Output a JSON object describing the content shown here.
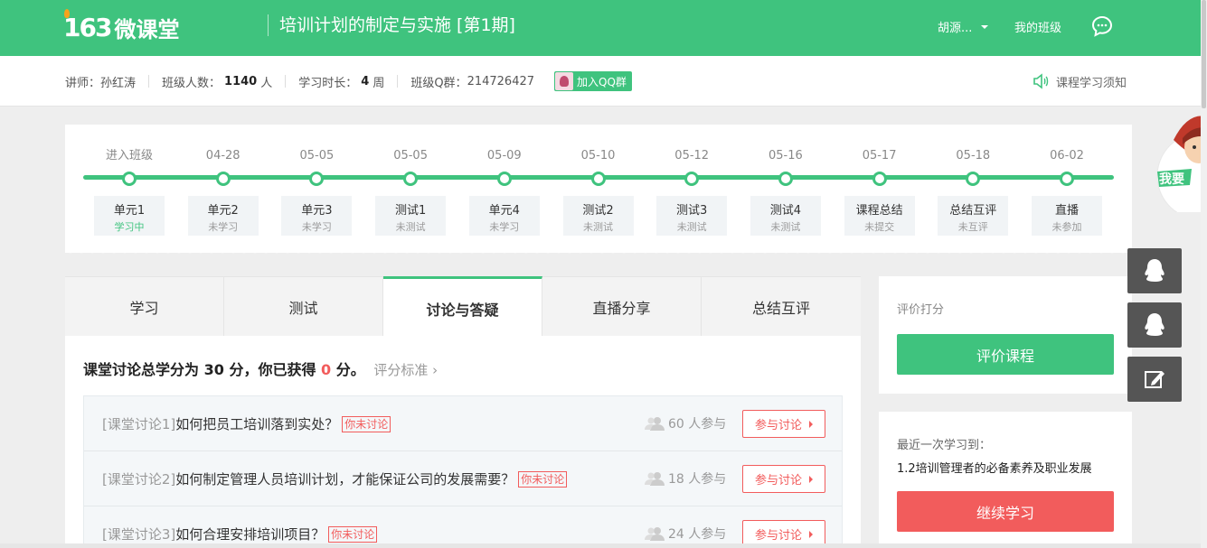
{
  "header": {
    "logo_num": "163",
    "logo_text": "微课堂",
    "course_title": "培训计划的制定与实施 [第1期]",
    "user_name": "胡源...",
    "my_class": "我的班级"
  },
  "info": {
    "teacher_label": "讲师：",
    "teacher_name": "孙红涛",
    "count_label": "班级人数：",
    "count_value": "1140",
    "count_unit": "人",
    "duration_label": "学习时长：",
    "duration_value": "4",
    "duration_unit": "周",
    "qq_group_label": "班级Q群：",
    "qq_group_number": "214726427",
    "join_qq": "加入QQ群",
    "notice": "课程学习须知"
  },
  "timeline": [
    {
      "date": "进入班级",
      "title": "单元1",
      "status": "学习中",
      "active": true
    },
    {
      "date": "04-28",
      "title": "单元2",
      "status": "未学习"
    },
    {
      "date": "05-05",
      "title": "单元3",
      "status": "未学习"
    },
    {
      "date": "05-05",
      "title": "测试1",
      "status": "未测试"
    },
    {
      "date": "05-09",
      "title": "单元4",
      "status": "未学习"
    },
    {
      "date": "05-10",
      "title": "测试2",
      "status": "未测试"
    },
    {
      "date": "05-12",
      "title": "测试3",
      "status": "未测试"
    },
    {
      "date": "05-16",
      "title": "测试4",
      "status": "未测试"
    },
    {
      "date": "05-17",
      "title": "课程总结",
      "status": "未提交"
    },
    {
      "date": "05-18",
      "title": "总结互评",
      "status": "未互评"
    },
    {
      "date": "06-02",
      "title": "直播",
      "status": "未参加"
    }
  ],
  "tabs": [
    {
      "label": "学习"
    },
    {
      "label": "测试"
    },
    {
      "label": "讨论与答疑",
      "active": true
    },
    {
      "label": "直播分享"
    },
    {
      "label": "总结互评"
    }
  ],
  "discussion": {
    "summary_prefix": "课堂讨论总学分为",
    "total_score": "30",
    "summary_mid": "分，你已获得",
    "earned_score": "0",
    "summary_suffix": "分。",
    "criteria_link": "评分标准",
    "items": [
      {
        "tag": "[课堂讨论1]",
        "question": "如何把员工培训落到实处？",
        "badge": "你未讨论",
        "participants": "60 人参与",
        "button": "参与讨论"
      },
      {
        "tag": "[课堂讨论2]",
        "question": "如何制定管理人员培训计划，才能保证公司的发展需要？",
        "badge": "你未讨论",
        "participants": "18 人参与",
        "button": "参与讨论"
      },
      {
        "tag": "[课堂讨论3]",
        "question": "如何合理安排培训项目？",
        "badge": "你未讨论",
        "participants": "24 人参与",
        "button": "参与讨论"
      }
    ]
  },
  "sidebar": {
    "rate_title": "评价打分",
    "rate_button": "评价课程",
    "recent_title": "最近一次学习到：",
    "recent_item": "1.2培训管理者的必备素养及职业发展",
    "continue_button": "继续学习"
  },
  "colors": {
    "brand_green": "#3fc37e",
    "accent_red": "#f25c5c"
  }
}
